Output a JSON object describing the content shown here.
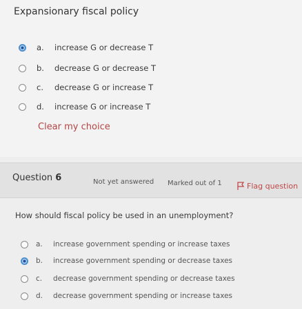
{
  "previous_question": {
    "title": "Expansionary fiscal policy",
    "options": [
      {
        "letter": "a.",
        "text": "increase G or decrease T",
        "selected": true
      },
      {
        "letter": "b.",
        "text": "decrease G or decrease T",
        "selected": false
      },
      {
        "letter": "c.",
        "text": "decrease G or increase T",
        "selected": false
      },
      {
        "letter": "d.",
        "text": "increase G or increase T",
        "selected": false
      }
    ],
    "clear_label": "Clear my choice"
  },
  "question": {
    "label_prefix": "Question",
    "number": "6",
    "status": "Not yet answered",
    "marks": "Marked out of 1",
    "flag_label": "Flag question",
    "text": "How should fiscal policy be used in an unemployment?",
    "options": [
      {
        "letter": "a.",
        "text": "increase government spending or increase taxes",
        "selected": false
      },
      {
        "letter": "b.",
        "text": "increase government spending or decrease taxes",
        "selected": true
      },
      {
        "letter": "c.",
        "text": "decrease government spending or decrease taxes",
        "selected": false
      },
      {
        "letter": "d.",
        "text": "decrease government spending or increase taxes",
        "selected": false
      }
    ]
  },
  "colors": {
    "accent": "#4a8fd0",
    "link_red": "#b34545"
  }
}
